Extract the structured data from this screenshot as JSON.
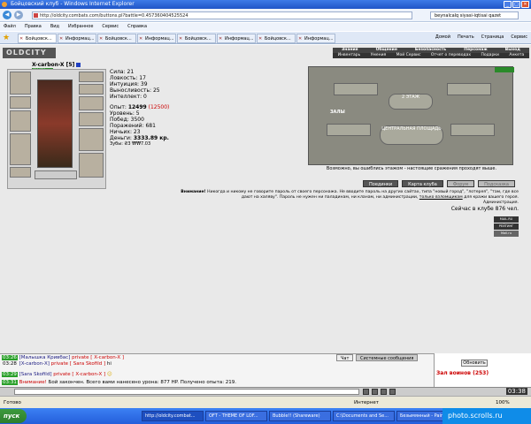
{
  "window": {
    "title": "Бойцовский клуб - Windows Internet Explorer"
  },
  "address": {
    "url": "http://oldcity.combats.com/buttons.pl?battle=0.457360404525524",
    "search": "beynalcalq siyasi-iqtisai qazet"
  },
  "menu": [
    "Файл",
    "Правка",
    "Вид",
    "Избранное",
    "Сервис",
    "Справка"
  ],
  "tabs": [
    "Бойцовск...",
    "Информац...",
    "Бойцовск...",
    "Информац...",
    "Бойцовск...",
    "Информац...",
    "Бойцовск...",
    "Информац..."
  ],
  "toolbar": {
    "home": "Домой",
    "print": "Печать",
    "page": "Страница",
    "tools": "Сервис"
  },
  "game": {
    "logo": "OLDCITY",
    "top_menu_row1": [
      "Знания",
      "Общение",
      "Безопасность",
      "Персонаж",
      "Выход"
    ],
    "top_menu_row2": [
      "Инвентарь",
      "Умения",
      "Мой Сервис",
      "Отчет о переводах",
      "Подарки",
      "Анкета"
    ],
    "char": {
      "name": "X-carbon-X",
      "level": "[5]",
      "hp": "621/621"
    },
    "stats": [
      {
        "label": "Сила:",
        "value": "21"
      },
      {
        "label": "Ловкость:",
        "value": "17"
      },
      {
        "label": "Интуиция:",
        "value": "39"
      },
      {
        "label": "Выносливость:",
        "value": "25"
      },
      {
        "label": "Интеллект:",
        "value": "0"
      }
    ],
    "exp": {
      "label": "Опыт:",
      "value": "12499",
      "next": "(12500)"
    },
    "details": [
      {
        "label": "Уровень:",
        "value": "5"
      },
      {
        "label": "Побед:",
        "value": "3500"
      },
      {
        "label": "Поражений:",
        "value": "681"
      },
      {
        "label": "Ничьих:",
        "value": "23"
      },
      {
        "label": "Деньги:",
        "value": "3333.89 кр."
      },
      {
        "label": "Зубы:",
        "value": "₴3 ₩₩7.03"
      }
    ],
    "map": {
      "l1": "2 ЭТАЖ",
      "l2": "ЗАЛЫ",
      "l3": "ЦЕНТРАЛЬНАЯ ПЛОЩАДЬ",
      "caption": "Возможно, вы ошиблись этажом - настоящие сражения проходят выше."
    },
    "buttons": [
      "Поединки",
      "Карта клуба",
      "Форум",
      "Подсказка"
    ],
    "warning": {
      "bold": "Внимание!",
      "text": "Никогда и никому не говорите пароль от своего персонажа. Не вводите пароль на других сайтах, типа \"новый город\", \"лотерея\", \"там, где все дают на халяву\". Пароль не нужен ни паладинам, ни кланам, ни администрации,",
      "link": "только взломщикам",
      "tail": "для кражи вашего героя.",
      "sign": "Администрация."
    },
    "online": "Сейчас в клубе 876 чел.",
    "badges": [
      "MAIL.RU",
      "РЕЙТИНГ",
      "Mail.ru"
    ]
  },
  "chat": {
    "tabs": [
      "Чат",
      "Системные сообщения"
    ],
    "lines": [
      {
        "time": "03:26",
        "nick": "[Малышка Кривбас]",
        "priv": "private [ X-carbon-X ]",
        "text": ""
      },
      {
        "time": "03:28",
        "nick": "[X-carbon-X]",
        "priv": "private [ Sara Skofild ]",
        "text": "hi"
      },
      {
        "time": "03:29",
        "nick": "[Sara Skofild]",
        "priv": "private [ X-carbon-X ]",
        "text": ""
      },
      {
        "time": "03:31",
        "nick": "Внимание!",
        "priv": "",
        "text": "Бой закончен. Всего вами нанесено урона: 877 HP. Получено опыта: 219."
      }
    ],
    "refresh": "Обновить",
    "hall": "Зал воинов (253)",
    "clock": "03:38"
  },
  "status": {
    "text": "Готово",
    "zone": "Интернет",
    "zoom": "100%"
  },
  "taskbar": {
    "start": "пуск",
    "items": [
      "http://oldcity.combat...",
      "OFT - THEME OF LOF...",
      "Bubble!! (Shareware)",
      "C:\\Documents and Se...",
      "Безымянный - Paint"
    ],
    "tray": "photo.scrolls.ru"
  }
}
